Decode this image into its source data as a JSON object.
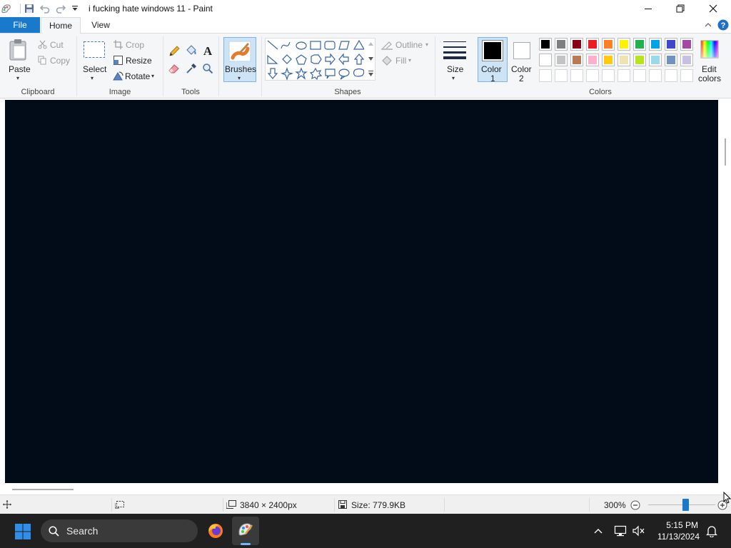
{
  "window": {
    "title": "i fucking hate windows 11 - Paint"
  },
  "tabs": {
    "file": "File",
    "home": "Home",
    "view": "View"
  },
  "ribbon": {
    "clipboard": {
      "paste": "Paste",
      "cut": "Cut",
      "copy": "Copy",
      "label": "Clipboard"
    },
    "image": {
      "select": "Select",
      "crop": "Crop",
      "resize": "Resize",
      "rotate": "Rotate",
      "label": "Image"
    },
    "tools": {
      "label": "Tools"
    },
    "brushes": {
      "label": "Brushes"
    },
    "shapes": {
      "outline": "Outline",
      "fill": "Fill",
      "label": "Shapes"
    },
    "size": {
      "label": "Size"
    },
    "color1": {
      "line1": "Color",
      "line2": "1",
      "value": "#000000"
    },
    "color2": {
      "line1": "Color",
      "line2": "2",
      "value": "#ffffff"
    },
    "colors": {
      "label": "Colors",
      "edit_line1": "Edit",
      "edit_line2": "colors",
      "row1": [
        "#000000",
        "#7f7f7f",
        "#880015",
        "#ed1c24",
        "#ff7f27",
        "#fff200",
        "#22b14c",
        "#00a2e8",
        "#3f48cc",
        "#a349a4"
      ],
      "row2": [
        "#ffffff",
        "#c3c3c3",
        "#b97a57",
        "#ffaec9",
        "#ffc90e",
        "#efe4b0",
        "#b5e61d",
        "#99d9ea",
        "#7092be",
        "#c8bfe7"
      ]
    }
  },
  "canvas": {
    "color": "#020c18"
  },
  "status": {
    "dimensions": "3840 × 2400px",
    "size": "Size: 779.9KB",
    "zoom": "300%"
  },
  "taskbar": {
    "search": "Search",
    "time": "5:15 PM",
    "date": "11/13/2024"
  }
}
